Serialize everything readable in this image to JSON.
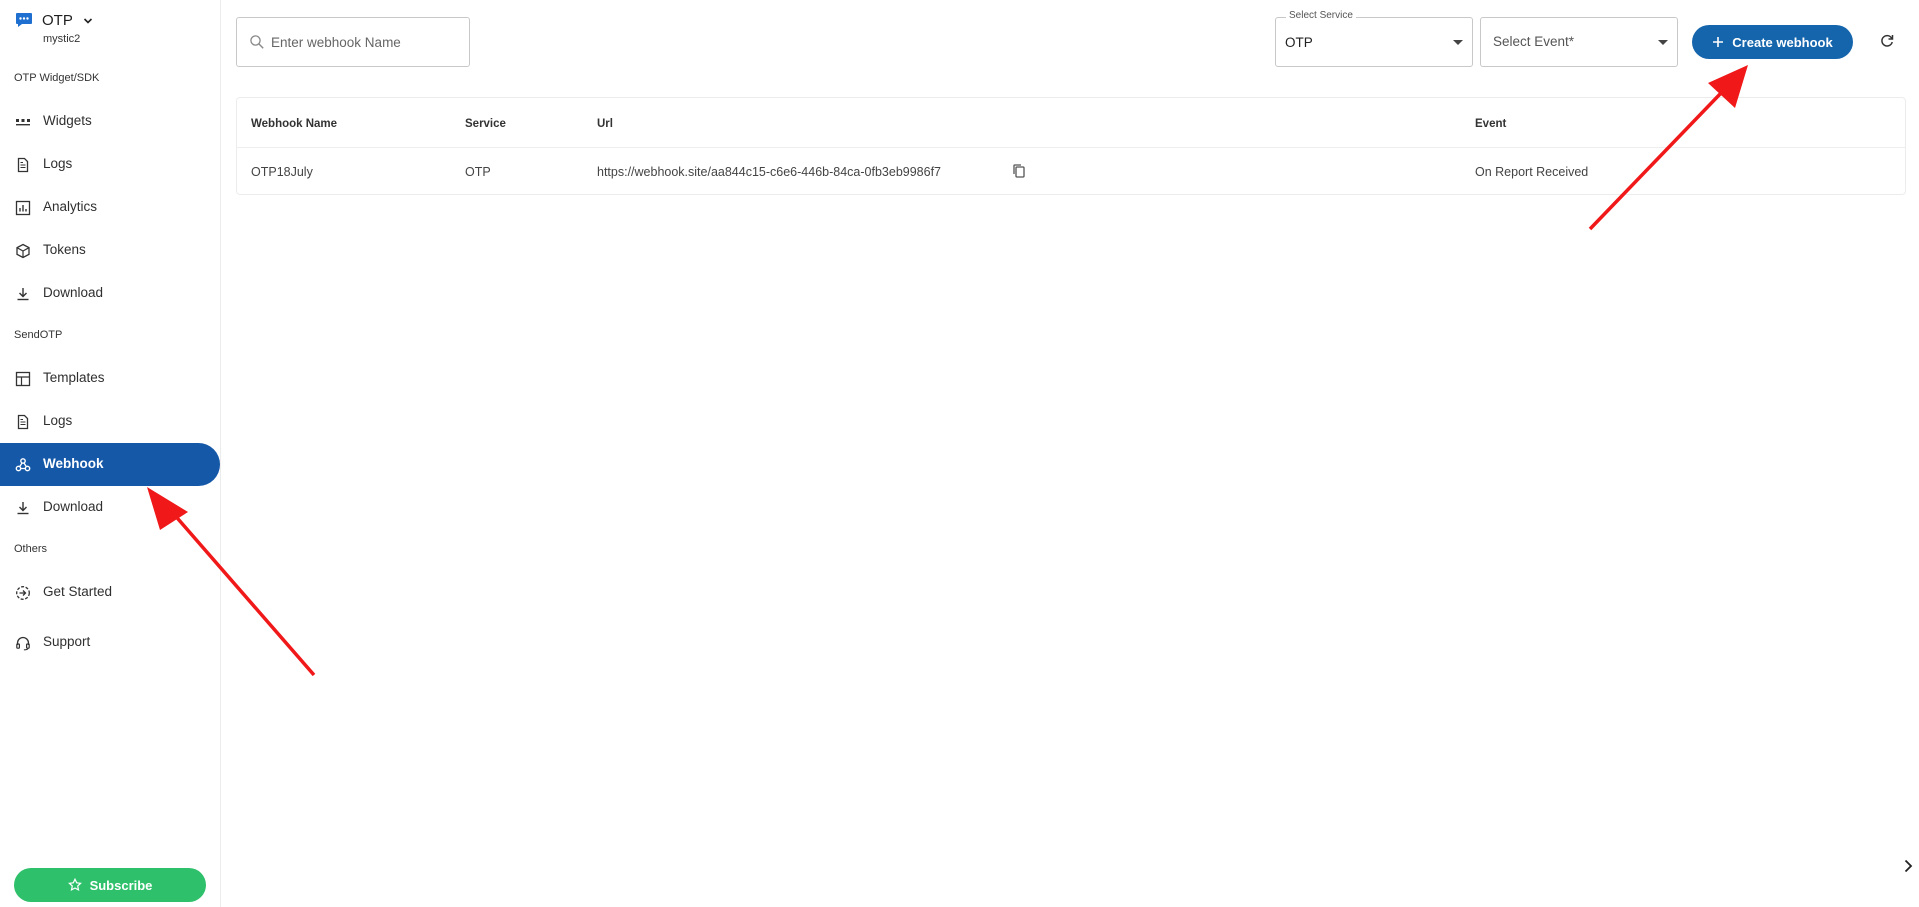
{
  "app": {
    "title": "OTP",
    "subtitle": "mystic2"
  },
  "sidebar": {
    "sections": [
      {
        "label": "OTP Widget/SDK"
      },
      {
        "label": "SendOTP"
      },
      {
        "label": "Others"
      }
    ],
    "items": [
      {
        "label": "Widgets",
        "icon": "widgets-icon"
      },
      {
        "label": "Logs",
        "icon": "document-icon"
      },
      {
        "label": "Analytics",
        "icon": "bar-chart-icon"
      },
      {
        "label": "Tokens",
        "icon": "cube-icon"
      },
      {
        "label": "Download",
        "icon": "download-icon"
      },
      {
        "label": "Templates",
        "icon": "template-icon"
      },
      {
        "label": "Logs",
        "icon": "document-icon"
      },
      {
        "label": "Webhook",
        "icon": "webhook-icon",
        "active": true
      },
      {
        "label": "Download",
        "icon": "download-icon"
      },
      {
        "label": "Get Started",
        "icon": "get-started-icon"
      },
      {
        "label": "Support",
        "icon": "headset-icon"
      }
    ],
    "subscribe_label": "Subscribe"
  },
  "toolbar": {
    "search_placeholder": "Enter webhook Name",
    "service_legend": "Select Service",
    "service_value": "OTP",
    "event_placeholder": "Select Event*",
    "create_label": "Create webhook"
  },
  "table": {
    "headers": [
      "Webhook Name",
      "Service",
      "Url",
      "Event"
    ],
    "rows": [
      {
        "name": "OTP18July",
        "service": "OTP",
        "url": "https://webhook.site/aa844c15-c6e6-446b-84ca-0fb3eb9986f7",
        "event": "On Report Received"
      }
    ]
  },
  "colors": {
    "accent": "#1565ad",
    "sidebar_active": "#1558a8",
    "subscribe": "#2ec06a",
    "annotation_arrow": "#f01818"
  }
}
